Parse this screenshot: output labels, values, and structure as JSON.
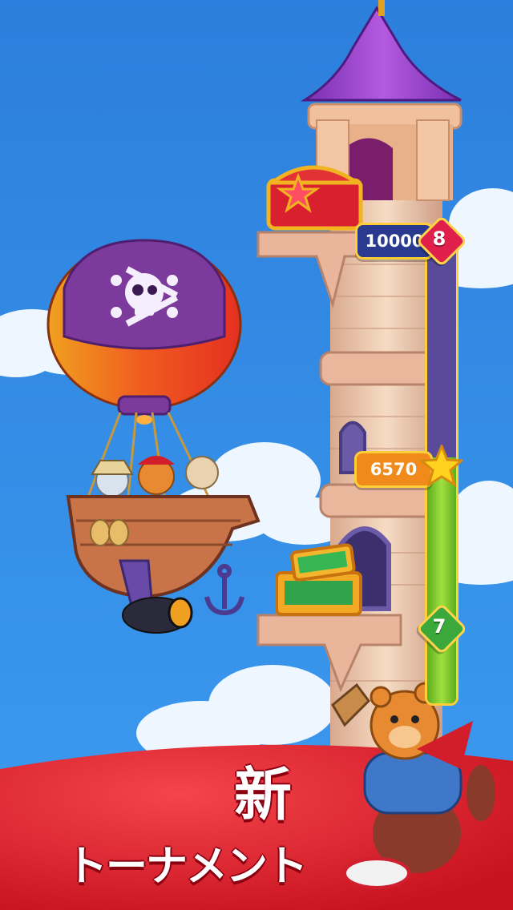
{
  "progress_bar": {
    "top_score": "10000",
    "top_level": "8",
    "current_score": "6570",
    "current_icon": "star-icon",
    "bottom_level": "7",
    "fill_fraction": 0.53
  },
  "promo": {
    "line1": "新",
    "line2": "トーナメント"
  },
  "colors": {
    "sky": "#2f86e0",
    "ground": "#e8202a",
    "bar_fill": "#7fcf2a",
    "bar_empty": "#5a4b9a",
    "gem_red": "#e0204a",
    "gem_green": "#3aa83a",
    "pill_navy": "#2a3b8f",
    "pill_orange": "#f08a1a"
  }
}
